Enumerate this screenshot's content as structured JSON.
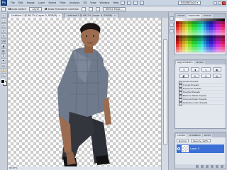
{
  "app": {
    "logo": "Ps"
  },
  "menubar": [
    "File",
    "Edit",
    "Image",
    "Layer",
    "Select",
    "Filter",
    "Analysis",
    "3D",
    "View",
    "Window",
    "Help"
  ],
  "workspace": "ESSENTIALS ▾",
  "options": {
    "auto_select_label": "Auto-Select:",
    "auto_select_value": "Layer",
    "show_transform_label": "Show Transform Controls",
    "refine_label": "Refine Edge..."
  },
  "tools": [
    "↖",
    "⬚",
    "✂",
    "⌖",
    "✎",
    "⌫",
    "▲",
    "◐",
    "T",
    "✒",
    "▭",
    "✋",
    "🔍"
  ],
  "document": {
    "tabs": [
      {
        "title": "Untitled-1 @ 66.7% (Layer 0, RGB/8)",
        "active": true
      },
      {
        "title": "Untitled-2 @ 66.7% (Layer 0, RGB/8)",
        "active": false
      }
    ],
    "status": "66.67%"
  },
  "panels": {
    "color_tabs": [
      "COLOR",
      "SWATCHES",
      "STYLES"
    ],
    "adjust_tabs": [
      "ADJUSTMENTS",
      "MASKS"
    ],
    "adj_icons": [
      "☀",
      "◑",
      "≈",
      "▣",
      "◧",
      "⚖",
      "◎",
      "▤"
    ],
    "presets": [
      "Levels Presets",
      "Curves Presets",
      "Exposure Presets",
      "Hue/Sat Presets",
      "Black & White Presets",
      "Channel Mixer Presets",
      "Selective Color Presets"
    ],
    "layers_tabs": [
      "LAYERS",
      "CHANNELS",
      "PATHS"
    ],
    "blend_mode": "Normal",
    "opacity_label": "Opacity: 100%",
    "layer_name": "Layer 0"
  },
  "colors": {
    "shirt": "#6f7b8c",
    "jeans": "#33363d",
    "skin": "#9b6c50",
    "hair": "#1a1512",
    "layer_selected": "#3b6fd6"
  }
}
